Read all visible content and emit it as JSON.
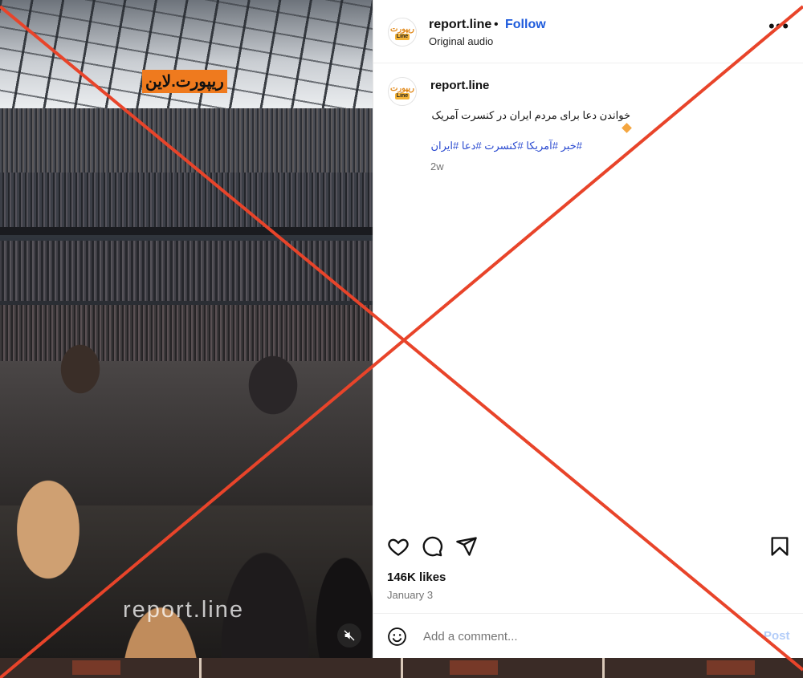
{
  "media": {
    "watermark_tag": "ریپورت.لاین",
    "watermark_text": "report.line",
    "mute_icon": "speaker-muted-icon"
  },
  "header": {
    "avatar_text_ar": "ریپورت",
    "avatar_text_en": "Line",
    "username": "report.line",
    "separator": "•",
    "follow_label": "Follow",
    "audio_label": "Original audio",
    "more_label": "•••"
  },
  "caption": {
    "username": "report.line",
    "text": "خواندن دعا برای مردم ایران در کنسرت آمریک",
    "hashtags": [
      "#خبر",
      "#آمریکا",
      "#کنسرت",
      "#دعا",
      "#ایران"
    ],
    "time": "2w"
  },
  "actions": {
    "icons": [
      "heart-icon",
      "comment-icon",
      "share-icon",
      "bookmark-icon"
    ]
  },
  "stats": {
    "likes": "146K likes",
    "date": "January 3"
  },
  "comment": {
    "placeholder": "Add a comment...",
    "post_label": "Post",
    "emoji_icon": "emoji-icon"
  },
  "overlay": {
    "cross_color": "#e8442a"
  }
}
